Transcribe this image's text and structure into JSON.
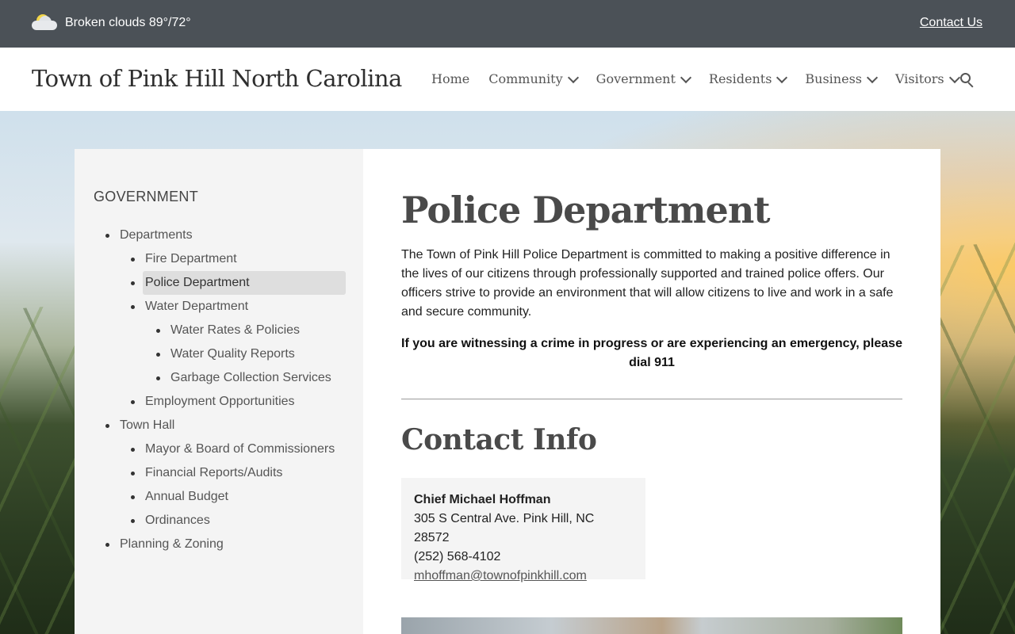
{
  "topbar": {
    "weather_text": "Broken clouds 89°/72°",
    "weather_icon": "partly-cloudy-icon",
    "contact_label": "Contact Us"
  },
  "header": {
    "site_title": "Town of Pink Hill North Carolina",
    "nav": [
      {
        "label": "Home",
        "has_dropdown": false
      },
      {
        "label": "Community",
        "has_dropdown": true
      },
      {
        "label": "Government",
        "has_dropdown": true
      },
      {
        "label": "Residents",
        "has_dropdown": true
      },
      {
        "label": "Business",
        "has_dropdown": true
      },
      {
        "label": "Visitors",
        "has_dropdown": true
      }
    ],
    "search_icon": "search-icon"
  },
  "sidebar": {
    "heading": "GOVERNMENT",
    "items": [
      {
        "label": "Departments",
        "level": 1
      },
      {
        "label": "Fire Department",
        "level": 2
      },
      {
        "label": "Police Department",
        "level": 2,
        "active": true
      },
      {
        "label": "Water Department",
        "level": 2
      },
      {
        "label": "Water Rates & Policies",
        "level": 3
      },
      {
        "label": "Water Quality Reports",
        "level": 3
      },
      {
        "label": "Garbage Collection Services",
        "level": 3
      },
      {
        "label": "Employment Opportunities",
        "level": 2
      },
      {
        "label": "Town Hall",
        "level": 1
      },
      {
        "label": "Mayor & Board of Commissioners",
        "level": 2
      },
      {
        "label": "Financial Reports/Audits",
        "level": 2
      },
      {
        "label": "Annual Budget",
        "level": 2
      },
      {
        "label": "Ordinances",
        "level": 2
      },
      {
        "label": "Planning & Zoning",
        "level": 1
      }
    ]
  },
  "main": {
    "title": "Police Department",
    "intro": "The Town of Pink Hill Police Department is committed to making a positive difference in the lives of our citizens through professionally supported and trained police offers. Our officers strive to provide an environment that will allow citizens to live and work in a safe and secure community.",
    "emergency": "If you are witnessing a crime in progress or are experiencing an emergency, please dial 911",
    "contact_heading": "Contact Info",
    "contact": {
      "name": "Chief Michael Hoffman",
      "address": "305 S Central Ave. Pink Hill, NC 28572",
      "phone": "(252) 568-4102",
      "email": "mhoffman@townofpinkhill.com"
    }
  },
  "colors": {
    "topbar_bg": "#4b5157",
    "sidebar_bg": "#f4f4f4",
    "active_item_bg": "#dedede"
  }
}
